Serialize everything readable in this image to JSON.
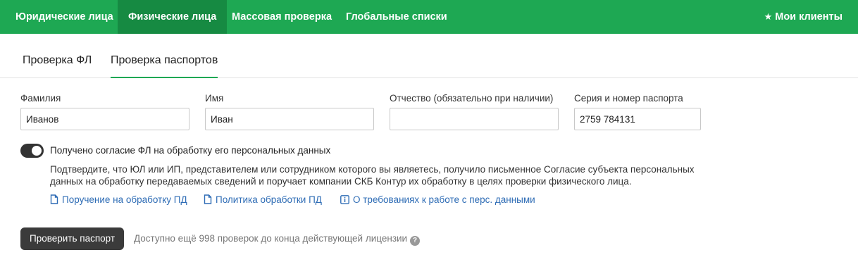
{
  "topnav": {
    "tabs": [
      {
        "label": "Юридические лица"
      },
      {
        "label": "Физические лица"
      },
      {
        "label": "Массовая проверка"
      },
      {
        "label": "Глобальные списки"
      }
    ],
    "active_tab": "Физические лица",
    "my_clients": "Мои клиенты"
  },
  "subtabs": [
    {
      "label": "Проверка ФЛ"
    },
    {
      "label": "Проверка паспортов"
    }
  ],
  "form": {
    "surname": {
      "label": "Фамилия",
      "value": "Иванов"
    },
    "name": {
      "label": "Имя",
      "value": "Иван"
    },
    "patronymic": {
      "label": "Отчество (обязательно при наличии)",
      "value": ""
    },
    "passport": {
      "label": "Серия и номер паспорта",
      "value": "2759 784131"
    }
  },
  "consent": {
    "checked": true,
    "label": "Получено согласие ФЛ на обработку его персональных данных",
    "text": "Подтвердите, что ЮЛ или ИП, представителем или сотрудником которого вы являетесь, получило письменное Согласие субъекта персональных данных на обработку передаваемых сведений и поручает компании СКБ Контур их обработку в целях проверки физического лица."
  },
  "links": [
    {
      "label": "Поручение на обработку ПД",
      "icon": "document-icon"
    },
    {
      "label": "Политика обработки ПД",
      "icon": "document-icon"
    },
    {
      "label": "О требованиях к работе с перс. данными",
      "icon": "info-icon"
    }
  ],
  "action": {
    "button": "Проверить паспорт",
    "limit_text": "Доступно ещё 998 проверок до конца действующей лицензии"
  },
  "colors": {
    "accent": "#1ea853",
    "accent_active": "#168a42",
    "link": "#2e6cb5"
  }
}
